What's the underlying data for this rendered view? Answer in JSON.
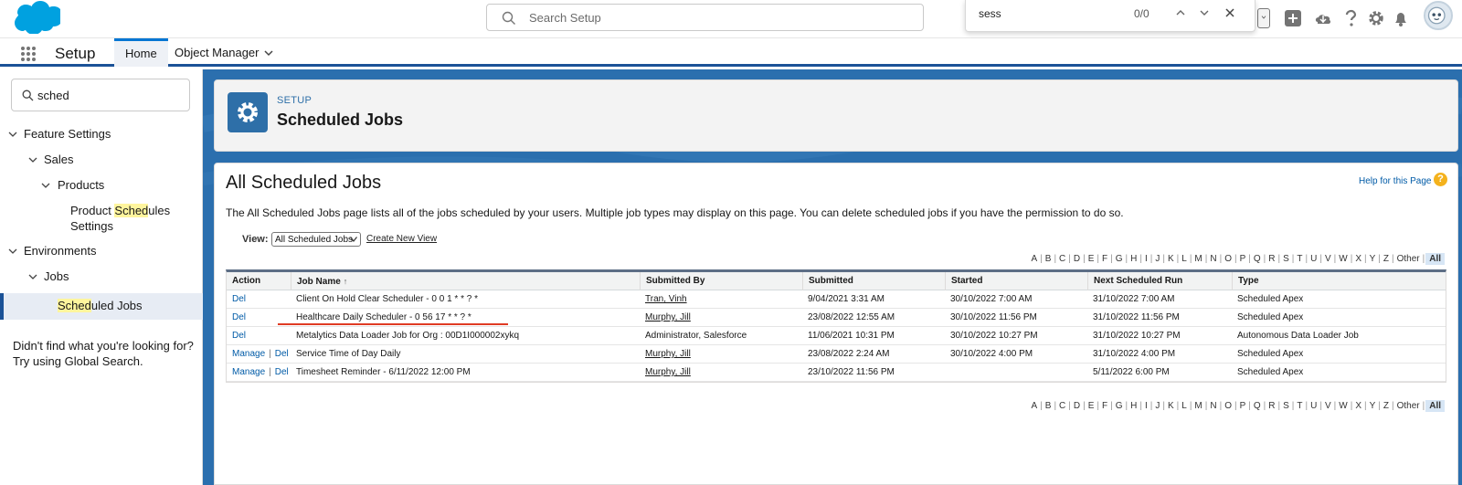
{
  "header": {
    "search_placeholder": "Search Setup",
    "find_bar": {
      "query": "sess",
      "count": "0/0"
    }
  },
  "context_bar": {
    "app_name": "Setup",
    "tabs": [
      {
        "label": "Home"
      },
      {
        "label": "Object Manager"
      }
    ]
  },
  "sidebar": {
    "quick_find_value": "sched",
    "tree": {
      "feature_settings": "Feature Settings",
      "sales": "Sales",
      "products": "Products",
      "product_schedules_pre": "Product ",
      "product_schedules_hl": "Sched",
      "product_schedules_post": "ules",
      "product_schedules_line2": "Settings",
      "environments": "Environments",
      "jobs": "Jobs",
      "scheduled_jobs_hl": "Sched",
      "scheduled_jobs_post": "uled Jobs"
    },
    "not_found_line1": "Didn't find what you're looking for?",
    "not_found_line2": "Try using Global Search."
  },
  "page_header": {
    "breadcrumb": "SETUP",
    "title": "Scheduled Jobs"
  },
  "content": {
    "title": "All Scheduled Jobs",
    "help_link": "Help for this Page",
    "help_icon": "?",
    "description": "The All Scheduled Jobs page lists all of the jobs scheduled by your users. Multiple job types may display on this page. You can delete scheduled jobs if you have the permission to do so.",
    "view_label": "View:",
    "view_selected": "All Scheduled Jobs",
    "create_new_view": "Create New View",
    "alpha_letters": [
      "A",
      "B",
      "C",
      "D",
      "E",
      "F",
      "G",
      "H",
      "I",
      "J",
      "K",
      "L",
      "M",
      "N",
      "O",
      "P",
      "Q",
      "R",
      "S",
      "T",
      "U",
      "V",
      "W",
      "X",
      "Y",
      "Z",
      "Other",
      "All"
    ],
    "alpha_current": "All"
  },
  "table": {
    "columns": {
      "action": "Action",
      "job_name": "Job Name",
      "sort_indicator": "↑",
      "submitted_by": "Submitted By",
      "submitted": "Submitted",
      "started": "Started",
      "next_run": "Next Scheduled Run",
      "type": "Type"
    },
    "manage_label": "Manage",
    "separator": "|",
    "rows": [
      {
        "manage": "",
        "del": "Del",
        "job_name": "Client On Hold Clear Scheduler - 0 0 1 * * ? *",
        "submitted_by": "Tran, Vinh",
        "submitted_by_link": true,
        "submitted": "9/04/2021 3:31 AM",
        "started": "30/10/2022 7:00 AM",
        "next_run": "31/10/2022 7:00 AM",
        "type": "Scheduled Apex"
      },
      {
        "manage": "",
        "del": "Del",
        "job_name": "Healthcare Daily Scheduler - 0 56 17 * * ? *",
        "submitted_by": "Murphy, Jill",
        "submitted_by_link": true,
        "submitted": "23/08/2022 12:55 AM",
        "started": "30/10/2022 11:56 PM",
        "next_run": "31/10/2022 11:56 PM",
        "type": "Scheduled Apex"
      },
      {
        "manage": "",
        "del": "Del",
        "job_name": "Metalytics Data Loader Job for Org : 00D1I000002xykq",
        "submitted_by": "Administrator, Salesforce",
        "submitted_by_link": false,
        "submitted": "11/06/2021 10:31 PM",
        "started": "30/10/2022 10:27 PM",
        "next_run": "31/10/2022 10:27 PM",
        "type": "Autonomous Data Loader Job"
      },
      {
        "manage": "Manage",
        "del": "Del",
        "job_name": "Service Time of Day Daily",
        "submitted_by": "Murphy, Jill",
        "submitted_by_link": true,
        "submitted": "23/08/2022 2:24 AM",
        "started": "30/10/2022 4:00 PM",
        "next_run": "31/10/2022 4:00 PM",
        "type": "Scheduled Apex"
      },
      {
        "manage": "Manage",
        "del": "Del",
        "job_name": "Timesheet Reminder - 6/11/2022 12:00 PM",
        "submitted_by": "Murphy, Jill",
        "submitted_by_link": true,
        "submitted": "23/10/2022 11:56 PM",
        "started": "",
        "next_run": "5/11/2022 6:00 PM",
        "type": "Scheduled Apex"
      }
    ]
  },
  "colors": {
    "brand_blue": "#2e6fa8",
    "link": "#015ba7",
    "highlight": "#fff59d",
    "annotation_red": "#e03b24",
    "help_orange": "#f4b21d"
  },
  "icons": [
    "salesforce-cloud-logo",
    "search-icon",
    "chevron-up-icon",
    "chevron-down-icon",
    "close-icon",
    "add-icon",
    "trailhead-icon",
    "help-icon",
    "gear-icon",
    "bell-icon",
    "avatar",
    "app-launcher-icon"
  ]
}
